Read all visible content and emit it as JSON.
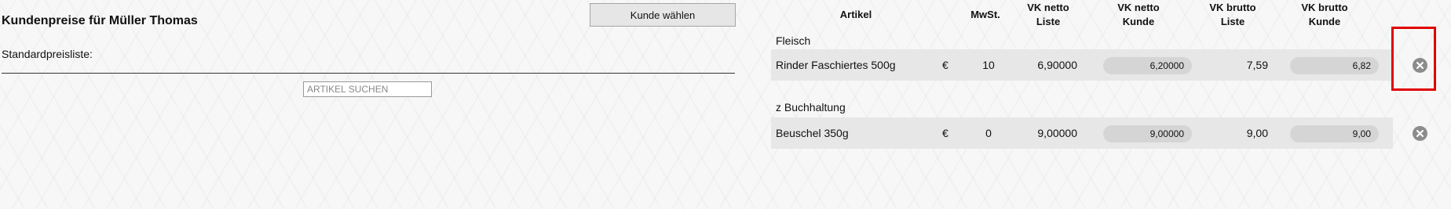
{
  "page": {
    "title": "Kundenpreise für Müller Thomas",
    "choose_customer_label": "Kunde wählen",
    "standard_pricelist_label": "Standardpreisliste:",
    "search_placeholder": "ARTIKEL SUCHEN"
  },
  "table": {
    "headers": {
      "article": "Artikel",
      "vat": "MwSt.",
      "vk_netto_liste": [
        "VK netto",
        "Liste"
      ],
      "vk_netto_kunde": [
        "VK netto",
        "Kunde"
      ],
      "vk_brutto_liste": [
        "VK brutto",
        "Liste"
      ],
      "vk_brutto_kunde": [
        "VK brutto",
        "Kunde"
      ]
    },
    "groups": [
      {
        "name": "Fleisch",
        "rows": [
          {
            "article": "Rinder Faschiertes 500g",
            "currency": "€",
            "vat": "10",
            "netto_liste": "6,90000",
            "netto_kunde": "6,20000",
            "brutto_liste": "7,59",
            "brutto_kunde": "6,82"
          }
        ]
      },
      {
        "name": "z Buchhaltung",
        "rows": [
          {
            "article": "Beuschel 350g",
            "currency": "€",
            "vat": "0",
            "netto_liste": "9,00000",
            "netto_kunde": "9,00000",
            "brutto_liste": "9,00",
            "brutto_kunde": "9,00"
          }
        ]
      }
    ]
  },
  "icons": {
    "delete": "close-circle-icon"
  },
  "colors": {
    "highlight": "#e00000",
    "row_background": "#e7e7e7",
    "pill_background": "#d5d5d5"
  }
}
